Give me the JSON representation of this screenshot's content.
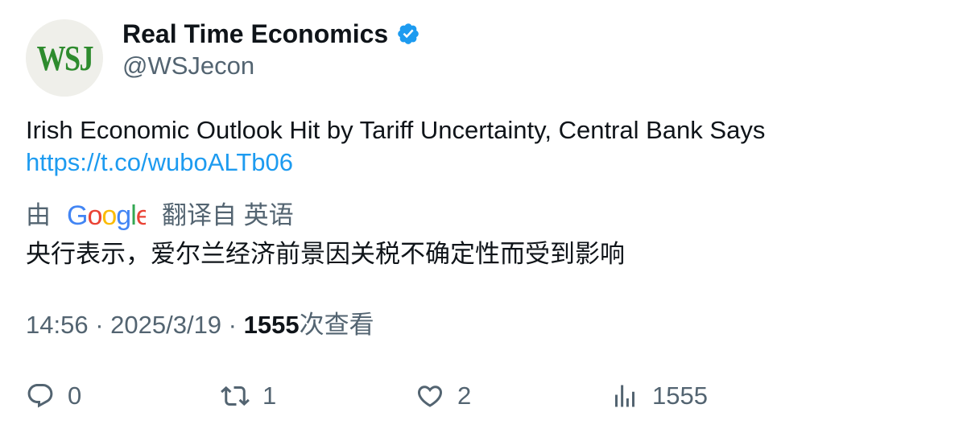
{
  "author": {
    "avatar_text": "WSJ",
    "display_name": "Real Time Economics",
    "handle": "@WSJecon",
    "verified_icon": "verified-badge-icon"
  },
  "tweet": {
    "text": "Irish Economic Outlook Hit by Tariff Uncertainty, Central Bank Says",
    "link": "https://t.co/wuboALTb06"
  },
  "translation": {
    "prefix": "由",
    "provider": "Google",
    "suffix": "翻译自 英语",
    "text": "央行表示，爱尔兰经济前景因关税不确定性而受到影响"
  },
  "meta": {
    "time": "14:56",
    "sep1": " · ",
    "date": "2025/3/19",
    "sep2": " · ",
    "views": "1555",
    "views_label": "次查看"
  },
  "actions": {
    "replies": "0",
    "retweets": "1",
    "likes": "2",
    "views": "1555"
  },
  "colors": {
    "link": "#1d9bf0",
    "secondary_text": "#536471",
    "verified": "#1d9bf0"
  }
}
